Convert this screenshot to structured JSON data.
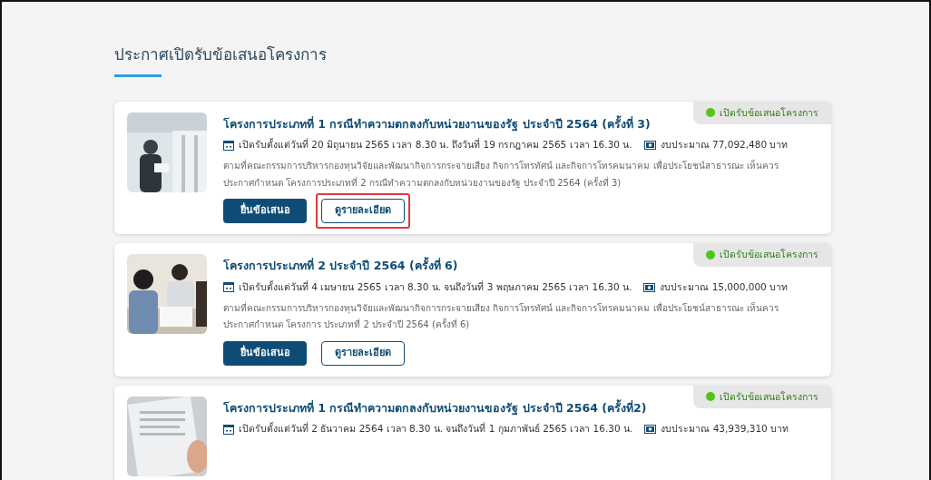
{
  "heading": "ประกาศเปิดรับข้อเสนอโครงการ",
  "projects": [
    {
      "status": "เปิดรับข้อเสนอโครงการ",
      "color": "#52c41a",
      "title": "โครงการประเภทที่ 1 กรณีทำความตกลงกับหน่วยงานของรัฐ ประจำปี 2564 (ครั้งที่ 3)",
      "period": "เปิดรับตั้งแต่วันที่ 20 มิถุนายน 2565 เวลา 8.30 น. ถึงวันที่ 19 กรกฎาคม 2565 เวลา 16.30 น.",
      "budget": "งบประมาณ 77,092,480 บาท",
      "description": "ตามที่คณะกรรมการบริหารกองทุนวิจัยและพัฒนากิจการกระจายเสียง กิจการโทรทัศน์ และกิจการโทรคมนาคม เพื่อประโยชน์สาธารณะ เห็นควรประกาศกำหนด โครงการประเภทที่ 2 กรณีทำความตกลงกับหน่วยงานของรัฐ ประจำปี 2564 (ครั้งที่ 3)",
      "buttons": [
        {
          "label": "ยื่นข้อเสนอ",
          "kind": "primary",
          "highlighted": false
        },
        {
          "label": "ดูรายละเอียด",
          "kind": "outline",
          "highlighted": true
        }
      ]
    },
    {
      "status": "เปิดรับข้อเสนอโครงการ",
      "color": "#52c41a",
      "title": "โครงการประเภทที่ 2 ประจำปี 2564 (ครั้งที่ 6)",
      "period": "เปิดรับตั้งแต่วันที่ 4 เมษายน 2565 เวลา 8.30 น. จนถึงวันที่ 3 พฤษภาคม 2565 เวลา 16.30 น.",
      "budget": "งบประมาณ 15,000,000 บาท",
      "description": "ตามที่คณะกรรมการบริหารกองทุนวิจัยและพัฒนากิจการกระจายเสียง กิจการโทรทัศน์ และกิจการโทรคมนาคม เพื่อประโยชน์สาธารณะ เห็นควรประกาศกำหนด โครงการ ประเภทที่ 2 ประจำปี 2564 (ครั้งที่ 6)",
      "buttons": [
        {
          "label": "ยื่นข้อเสนอ",
          "kind": "primary",
          "highlighted": false
        },
        {
          "label": "ดูรายละเอียด",
          "kind": "outline",
          "highlighted": false
        }
      ]
    },
    {
      "status": "เปิดรับข้อเสนอโครงการ",
      "color": "#52c41a",
      "title": "โครงการประเภทที่ 1 กรณีทำความตกลงกับหน่วยงานของรัฐ ประจำปี 2564 (ครั้งที่2)",
      "period": "เปิดรับตั้งแต่วันที่ 2 ธันวาคม 2564 เวลา 8.30 น. จนถึงวันที่ 1 กุมภาพันธ์ 2565 เวลา 16.30 น.",
      "budget": "งบประมาณ 43,939,310 บาท"
    }
  ]
}
